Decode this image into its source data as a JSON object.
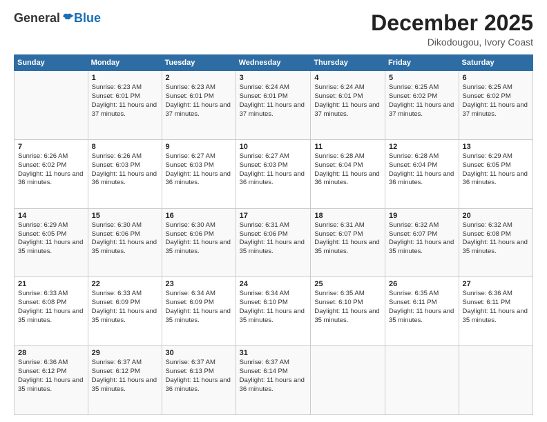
{
  "logo": {
    "general": "General",
    "blue": "Blue"
  },
  "header": {
    "month": "December 2025",
    "location": "Dikodougou, Ivory Coast"
  },
  "days_of_week": [
    "Sunday",
    "Monday",
    "Tuesday",
    "Wednesday",
    "Thursday",
    "Friday",
    "Saturday"
  ],
  "weeks": [
    [
      {
        "day": "",
        "sunrise": "",
        "sunset": "",
        "daylight": ""
      },
      {
        "day": "1",
        "sunrise": "Sunrise: 6:23 AM",
        "sunset": "Sunset: 6:01 PM",
        "daylight": "Daylight: 11 hours and 37 minutes."
      },
      {
        "day": "2",
        "sunrise": "Sunrise: 6:23 AM",
        "sunset": "Sunset: 6:01 PM",
        "daylight": "Daylight: 11 hours and 37 minutes."
      },
      {
        "day": "3",
        "sunrise": "Sunrise: 6:24 AM",
        "sunset": "Sunset: 6:01 PM",
        "daylight": "Daylight: 11 hours and 37 minutes."
      },
      {
        "day": "4",
        "sunrise": "Sunrise: 6:24 AM",
        "sunset": "Sunset: 6:01 PM",
        "daylight": "Daylight: 11 hours and 37 minutes."
      },
      {
        "day": "5",
        "sunrise": "Sunrise: 6:25 AM",
        "sunset": "Sunset: 6:02 PM",
        "daylight": "Daylight: 11 hours and 37 minutes."
      },
      {
        "day": "6",
        "sunrise": "Sunrise: 6:25 AM",
        "sunset": "Sunset: 6:02 PM",
        "daylight": "Daylight: 11 hours and 37 minutes."
      }
    ],
    [
      {
        "day": "7",
        "sunrise": "Sunrise: 6:26 AM",
        "sunset": "Sunset: 6:02 PM",
        "daylight": "Daylight: 11 hours and 36 minutes."
      },
      {
        "day": "8",
        "sunrise": "Sunrise: 6:26 AM",
        "sunset": "Sunset: 6:03 PM",
        "daylight": "Daylight: 11 hours and 36 minutes."
      },
      {
        "day": "9",
        "sunrise": "Sunrise: 6:27 AM",
        "sunset": "Sunset: 6:03 PM",
        "daylight": "Daylight: 11 hours and 36 minutes."
      },
      {
        "day": "10",
        "sunrise": "Sunrise: 6:27 AM",
        "sunset": "Sunset: 6:03 PM",
        "daylight": "Daylight: 11 hours and 36 minutes."
      },
      {
        "day": "11",
        "sunrise": "Sunrise: 6:28 AM",
        "sunset": "Sunset: 6:04 PM",
        "daylight": "Daylight: 11 hours and 36 minutes."
      },
      {
        "day": "12",
        "sunrise": "Sunrise: 6:28 AM",
        "sunset": "Sunset: 6:04 PM",
        "daylight": "Daylight: 11 hours and 36 minutes."
      },
      {
        "day": "13",
        "sunrise": "Sunrise: 6:29 AM",
        "sunset": "Sunset: 6:05 PM",
        "daylight": "Daylight: 11 hours and 36 minutes."
      }
    ],
    [
      {
        "day": "14",
        "sunrise": "Sunrise: 6:29 AM",
        "sunset": "Sunset: 6:05 PM",
        "daylight": "Daylight: 11 hours and 35 minutes."
      },
      {
        "day": "15",
        "sunrise": "Sunrise: 6:30 AM",
        "sunset": "Sunset: 6:06 PM",
        "daylight": "Daylight: 11 hours and 35 minutes."
      },
      {
        "day": "16",
        "sunrise": "Sunrise: 6:30 AM",
        "sunset": "Sunset: 6:06 PM",
        "daylight": "Daylight: 11 hours and 35 minutes."
      },
      {
        "day": "17",
        "sunrise": "Sunrise: 6:31 AM",
        "sunset": "Sunset: 6:06 PM",
        "daylight": "Daylight: 11 hours and 35 minutes."
      },
      {
        "day": "18",
        "sunrise": "Sunrise: 6:31 AM",
        "sunset": "Sunset: 6:07 PM",
        "daylight": "Daylight: 11 hours and 35 minutes."
      },
      {
        "day": "19",
        "sunrise": "Sunrise: 6:32 AM",
        "sunset": "Sunset: 6:07 PM",
        "daylight": "Daylight: 11 hours and 35 minutes."
      },
      {
        "day": "20",
        "sunrise": "Sunrise: 6:32 AM",
        "sunset": "Sunset: 6:08 PM",
        "daylight": "Daylight: 11 hours and 35 minutes."
      }
    ],
    [
      {
        "day": "21",
        "sunrise": "Sunrise: 6:33 AM",
        "sunset": "Sunset: 6:08 PM",
        "daylight": "Daylight: 11 hours and 35 minutes."
      },
      {
        "day": "22",
        "sunrise": "Sunrise: 6:33 AM",
        "sunset": "Sunset: 6:09 PM",
        "daylight": "Daylight: 11 hours and 35 minutes."
      },
      {
        "day": "23",
        "sunrise": "Sunrise: 6:34 AM",
        "sunset": "Sunset: 6:09 PM",
        "daylight": "Daylight: 11 hours and 35 minutes."
      },
      {
        "day": "24",
        "sunrise": "Sunrise: 6:34 AM",
        "sunset": "Sunset: 6:10 PM",
        "daylight": "Daylight: 11 hours and 35 minutes."
      },
      {
        "day": "25",
        "sunrise": "Sunrise: 6:35 AM",
        "sunset": "Sunset: 6:10 PM",
        "daylight": "Daylight: 11 hours and 35 minutes."
      },
      {
        "day": "26",
        "sunrise": "Sunrise: 6:35 AM",
        "sunset": "Sunset: 6:11 PM",
        "daylight": "Daylight: 11 hours and 35 minutes."
      },
      {
        "day": "27",
        "sunrise": "Sunrise: 6:36 AM",
        "sunset": "Sunset: 6:11 PM",
        "daylight": "Daylight: 11 hours and 35 minutes."
      }
    ],
    [
      {
        "day": "28",
        "sunrise": "Sunrise: 6:36 AM",
        "sunset": "Sunset: 6:12 PM",
        "daylight": "Daylight: 11 hours and 35 minutes."
      },
      {
        "day": "29",
        "sunrise": "Sunrise: 6:37 AM",
        "sunset": "Sunset: 6:12 PM",
        "daylight": "Daylight: 11 hours and 35 minutes."
      },
      {
        "day": "30",
        "sunrise": "Sunrise: 6:37 AM",
        "sunset": "Sunset: 6:13 PM",
        "daylight": "Daylight: 11 hours and 36 minutes."
      },
      {
        "day": "31",
        "sunrise": "Sunrise: 6:37 AM",
        "sunset": "Sunset: 6:14 PM",
        "daylight": "Daylight: 11 hours and 36 minutes."
      },
      {
        "day": "",
        "sunrise": "",
        "sunset": "",
        "daylight": ""
      },
      {
        "day": "",
        "sunrise": "",
        "sunset": "",
        "daylight": ""
      },
      {
        "day": "",
        "sunrise": "",
        "sunset": "",
        "daylight": ""
      }
    ]
  ]
}
